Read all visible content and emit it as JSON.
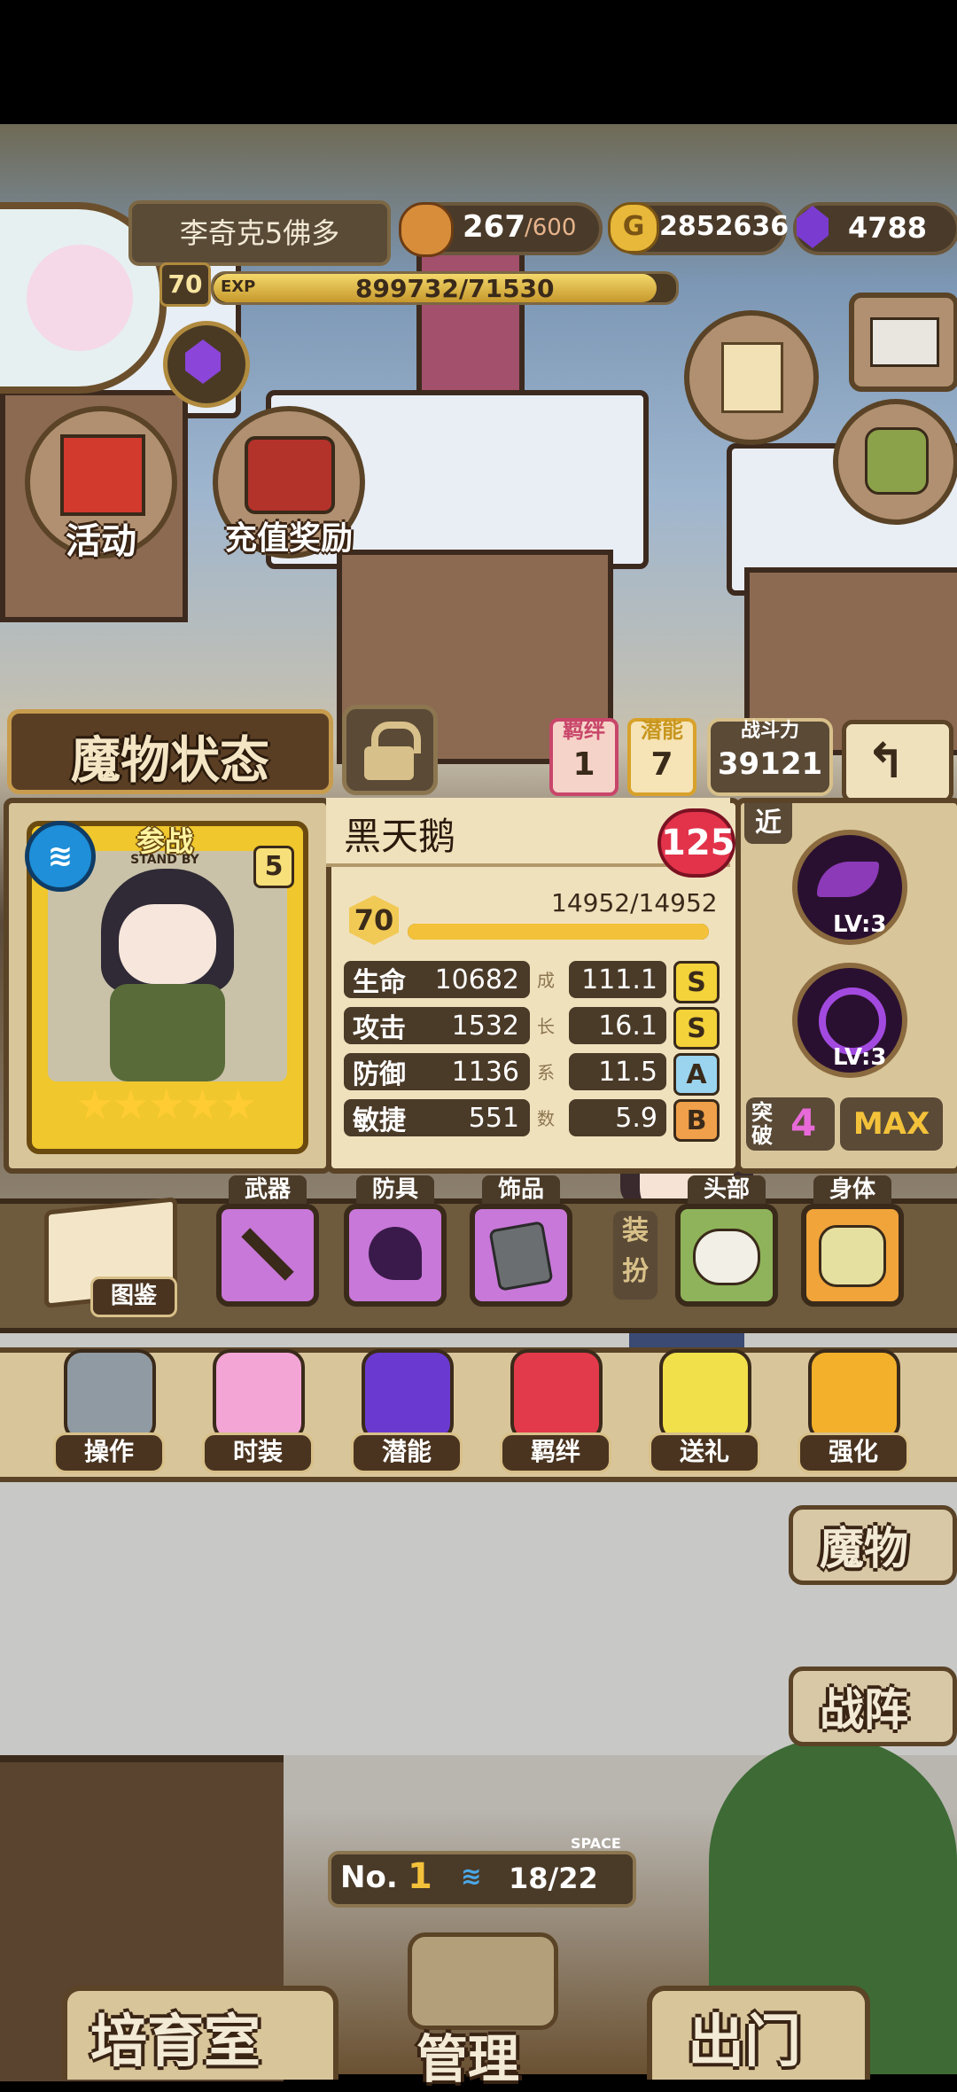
{
  "player": {
    "name": "李奇克5佛多",
    "level": "70",
    "exp_label": "EXP",
    "exp_text": "899732/71530",
    "stamina_current": "267",
    "stamina_max": "/600",
    "gold": "2852636",
    "gems": "4788"
  },
  "left_events": {
    "activity": "活动",
    "recharge_reward": "充值奖励"
  },
  "monster_status": {
    "title": "魔物状态",
    "bond_label": "羁绊",
    "bond_value": "1",
    "potential_label": "潜能",
    "potential_value": "7",
    "power_label": "战斗力",
    "power_value": "39121"
  },
  "monster": {
    "name": "黑天鹅",
    "affinity": "125",
    "level": "70",
    "exp_text": "14952/14952",
    "exp_fraction": 1.0,
    "standby_label": "参战",
    "standby_sub": "STAND BY",
    "rank": "5",
    "stars": 5,
    "range_label": "近",
    "stats": [
      {
        "name": "生命",
        "value": "10682",
        "growth": "111.1",
        "grade": "S",
        "grade_color": "#f3d23a"
      },
      {
        "name": "攻击",
        "value": "1532",
        "growth": "16.1",
        "grade": "S",
        "grade_color": "#f3d23a"
      },
      {
        "name": "防御",
        "value": "1136",
        "growth": "11.5",
        "grade": "A",
        "grade_color": "#9ad4ef"
      },
      {
        "name": "敏捷",
        "value": "551",
        "growth": "5.9",
        "grade": "B",
        "grade_color": "#f0a04a"
      }
    ],
    "growth_vertical": [
      "成",
      "长",
      "系",
      "数"
    ],
    "skills": [
      {
        "level": "LV:3"
      },
      {
        "level": "LV:3"
      }
    ],
    "breakthrough_label": "突破",
    "breakthrough_value": "4",
    "max_label": "MAX"
  },
  "equipment": {
    "codex_label": "图鉴",
    "weapon_label": "武器",
    "armor_label": "防具",
    "accessory_label": "饰品",
    "dressup_label": "装扮",
    "head_label": "头部",
    "body_label": "身体"
  },
  "menu": [
    {
      "label": "操作",
      "icon": "gear-icon"
    },
    {
      "label": "时装",
      "icon": "outfit-icon"
    },
    {
      "label": "潜能",
      "icon": "demon-icon"
    },
    {
      "label": "羁绊",
      "icon": "hearts-icon"
    },
    {
      "label": "送礼",
      "icon": "gift-icon"
    },
    {
      "label": "强化",
      "icon": "arrows-up-icon"
    }
  ],
  "side_buttons": {
    "monster": "魔物",
    "formation": "战阵"
  },
  "room": {
    "number_label": "No.",
    "number": "1",
    "space_label": "SPACE",
    "space": "18/22"
  },
  "bottom_nav": {
    "nursery": "培育室",
    "manage": "管理",
    "go_out": "出门"
  }
}
